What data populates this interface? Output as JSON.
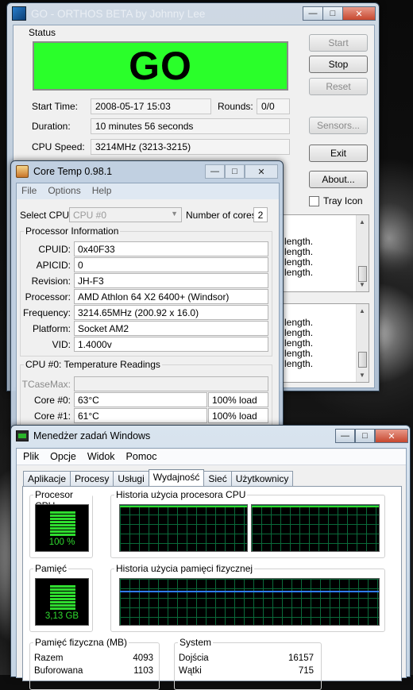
{
  "orthos": {
    "title": "GO - ORTHOS BETA by Johnny Lee",
    "status_group": "Status",
    "status_text": "GO",
    "start_time_label": "Start Time:",
    "start_time_value": "2008-05-17 15:03",
    "rounds_label": "Rounds:",
    "rounds_value": "0/0",
    "duration_label": "Duration:",
    "duration_value": "10 minutes 56 seconds",
    "cpu_speed_label": "CPU Speed:",
    "cpu_speed_value": "3214MHz (3213-3215)",
    "buttons": {
      "start": "Start",
      "stop": "Stop",
      "reset": "Reset",
      "sensors": "Sensors...",
      "exit": "Exit",
      "about": "About..."
    },
    "tray_icon_label": "Tray Icon",
    "tray_icon_checked": false,
    "log1_lines": [
      "length.",
      "length.",
      "length.",
      "length."
    ],
    "log2_lines": [
      "length.",
      "length.",
      "length.",
      "length.",
      "length."
    ]
  },
  "coretemp": {
    "title": "Core Temp 0.98.1",
    "menu": [
      "File",
      "Options",
      "Help"
    ],
    "select_cpu_label": "Select CPU:",
    "select_cpu_value": "CPU #0",
    "num_cores_label": "Number of cores",
    "num_cores_value": "2",
    "proc_info_legend": "Processor Information",
    "fields": [
      {
        "label": "CPUID:",
        "value": "0x40F33"
      },
      {
        "label": "APICID:",
        "value": "0"
      },
      {
        "label": "Revision:",
        "value": "JH-F3"
      },
      {
        "label": "Processor:",
        "value": "AMD Athlon 64 X2 6400+ (Windsor)"
      },
      {
        "label": "Frequency:",
        "value": "3214.65MHz (200.92 x 16.0)"
      },
      {
        "label": "Platform:",
        "value": "Socket AM2"
      },
      {
        "label": "VID:",
        "value": "1.4000v"
      }
    ],
    "temp_legend": "CPU #0: Temperature Readings",
    "tcasemax_label": "TCaseMax:",
    "tcasemax_value": "",
    "cores": [
      {
        "label": "Core #0:",
        "temp": "63°C",
        "load": "100% load"
      },
      {
        "label": "Core #1:",
        "temp": "61°C",
        "load": "100% load"
      }
    ]
  },
  "taskmgr": {
    "title": "Menedżer zadań Windows",
    "menu": [
      "Plik",
      "Opcje",
      "Widok",
      "Pomoc"
    ],
    "tabs": [
      "Aplikacje",
      "Procesy",
      "Usługi",
      "Wydajność",
      "Sieć",
      "Użytkownicy"
    ],
    "active_tab": "Wydajność",
    "cpu_title": "Procesor CPU",
    "cpu_value": "100 %",
    "cpu_usage_percent": 100,
    "cpu_history_title": "Historia użycia procesora CPU",
    "mem_title": "Pamięć",
    "mem_value": "3,13 GB",
    "mem_history_title": "Historia użycia pamięci fizycznej",
    "physmem_title": "Pamięć fizyczna (MB)",
    "physmem_rows": [
      {
        "label": "Razem",
        "value": "4093"
      },
      {
        "label": "Buforowana",
        "value": "1103"
      }
    ],
    "system_title": "System",
    "system_rows": [
      {
        "label": "Dojścia",
        "value": "16157"
      },
      {
        "label": "Wątki",
        "value": "715"
      }
    ]
  }
}
